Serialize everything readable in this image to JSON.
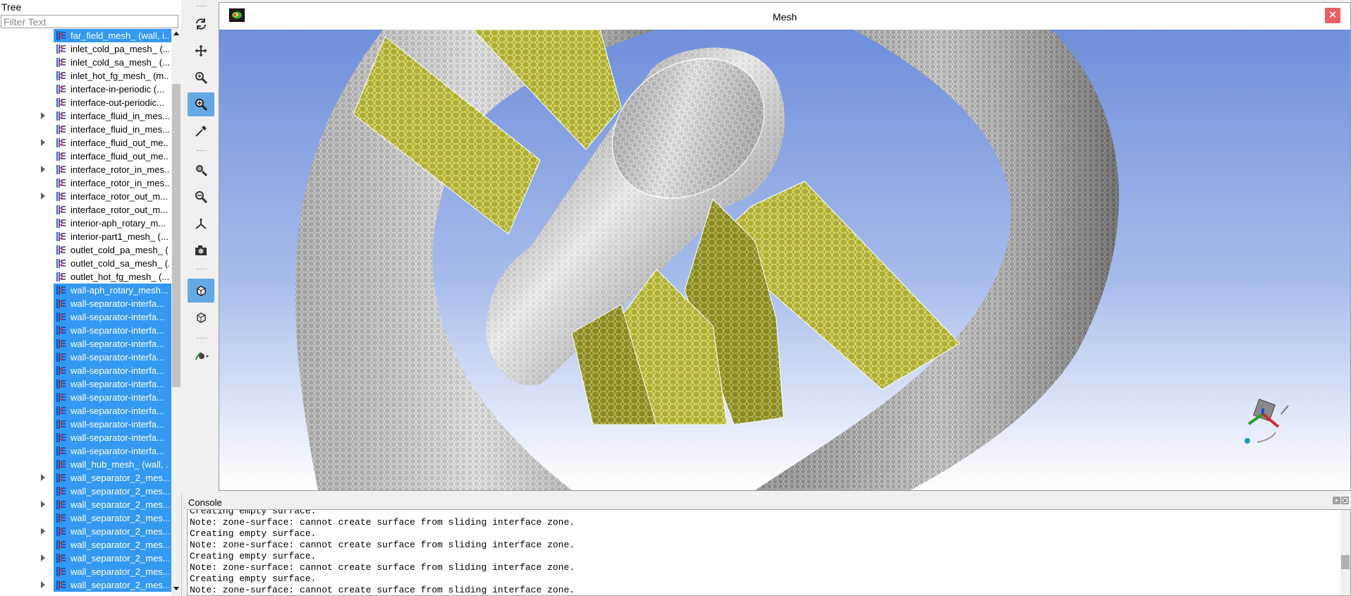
{
  "tree": {
    "title": "Tree",
    "filter_placeholder": "Filter Text",
    "items": [
      {
        "label": "far_field_mesh_ (wall, i...",
        "selected": true,
        "expandable": false
      },
      {
        "label": "inlet_cold_pa_mesh_ (...",
        "selected": false,
        "expandable": false
      },
      {
        "label": "inlet_cold_sa_mesh_ (...",
        "selected": false,
        "expandable": false
      },
      {
        "label": "inlet_hot_fg_mesh_ (m...",
        "selected": false,
        "expandable": false
      },
      {
        "label": "interface-in-periodic (...",
        "selected": false,
        "expandable": false
      },
      {
        "label": "interface-out-periodic...",
        "selected": false,
        "expandable": false
      },
      {
        "label": "interface_fluid_in_mes...",
        "selected": false,
        "expandable": true
      },
      {
        "label": "interface_fluid_in_mes...",
        "selected": false,
        "expandable": false
      },
      {
        "label": "interface_fluid_out_me...",
        "selected": false,
        "expandable": true
      },
      {
        "label": "interface_fluid_out_me...",
        "selected": false,
        "expandable": false
      },
      {
        "label": "interface_rotor_in_mes...",
        "selected": false,
        "expandable": true
      },
      {
        "label": "interface_rotor_in_mes...",
        "selected": false,
        "expandable": false
      },
      {
        "label": "interface_rotor_out_m...",
        "selected": false,
        "expandable": true
      },
      {
        "label": "interface_rotor_out_m...",
        "selected": false,
        "expandable": false
      },
      {
        "label": "interior-aph_rotary_m...",
        "selected": false,
        "expandable": false
      },
      {
        "label": "interior-part1_mesh_ (...",
        "selected": false,
        "expandable": false
      },
      {
        "label": "outlet_cold_pa_mesh_ (...",
        "selected": false,
        "expandable": false
      },
      {
        "label": "outlet_cold_sa_mesh_ (...",
        "selected": false,
        "expandable": false
      },
      {
        "label": "outlet_hot_fg_mesh_ (...",
        "selected": false,
        "expandable": false
      },
      {
        "label": "wall-aph_rotary_mesh...",
        "selected": true,
        "expandable": false
      },
      {
        "label": "wall-separator-interfa...",
        "selected": true,
        "expandable": false
      },
      {
        "label": "wall-separator-interfa...",
        "selected": true,
        "expandable": false
      },
      {
        "label": "wall-separator-interfa...",
        "selected": true,
        "expandable": false
      },
      {
        "label": "wall-separator-interfa...",
        "selected": true,
        "expandable": false
      },
      {
        "label": "wall-separator-interfa...",
        "selected": true,
        "expandable": false
      },
      {
        "label": "wall-separator-interfa...",
        "selected": true,
        "expandable": false
      },
      {
        "label": "wall-separator-interfa...",
        "selected": true,
        "expandable": false
      },
      {
        "label": "wall-separator-interfa...",
        "selected": true,
        "expandable": false
      },
      {
        "label": "wall-separator-interfa...",
        "selected": true,
        "expandable": false
      },
      {
        "label": "wall-separator-interfa...",
        "selected": true,
        "expandable": false
      },
      {
        "label": "wall-separator-interfa...",
        "selected": true,
        "expandable": false
      },
      {
        "label": "wall-separator-interfa...",
        "selected": true,
        "expandable": false
      },
      {
        "label": "wall_hub_mesh_ (wall, ...",
        "selected": true,
        "expandable": false
      },
      {
        "label": "wall_separator_2_mes...",
        "selected": true,
        "expandable": true
      },
      {
        "label": "wall_separator_2_mes...",
        "selected": true,
        "expandable": false
      },
      {
        "label": "wall_separator_2_mes...",
        "selected": true,
        "expandable": true
      },
      {
        "label": "wall_separator_2_mes...",
        "selected": true,
        "expandable": false
      },
      {
        "label": "wall_separator_2_mes...",
        "selected": true,
        "expandable": true
      },
      {
        "label": "wall_separator_2_mes...",
        "selected": true,
        "expandable": false
      },
      {
        "label": "wall_separator_2_mes...",
        "selected": true,
        "expandable": true
      },
      {
        "label": "wall_separator_2_mes...",
        "selected": true,
        "expandable": false
      },
      {
        "label": "wall_separator_2_mes...",
        "selected": true,
        "expandable": true
      }
    ]
  },
  "toolbar": {
    "buttons": [
      {
        "name": "rotate-icon",
        "active": false
      },
      {
        "name": "pan-icon",
        "active": false
      },
      {
        "name": "zoom-icon",
        "active": false
      },
      {
        "name": "zoom-box-icon",
        "active": true
      },
      {
        "name": "probe-icon",
        "active": false
      },
      {
        "name": "fit-to-window-icon",
        "active": false
      },
      {
        "name": "zoom-out-icon",
        "active": false
      },
      {
        "name": "axes-icon",
        "active": false
      },
      {
        "name": "camera-icon",
        "active": false
      },
      {
        "name": "solid-view-icon",
        "active": true
      },
      {
        "name": "wireframe-view-icon",
        "active": false
      },
      {
        "name": "view-options-icon",
        "active": false
      }
    ]
  },
  "viewport": {
    "title": "Mesh",
    "close_label": "✕",
    "colors": {
      "sky_top": "#6f8fdb",
      "sky_bottom": "#ffffff",
      "mesh_gray": "#b8b8b8",
      "mesh_yellow": "#b3b33b"
    }
  },
  "console": {
    "title": "Console",
    "lines": [
      "Creating empty surface.",
      "Note: zone-surface: cannot create surface from sliding interface zone.",
      "Creating empty surface.",
      "Note: zone-surface: cannot create surface from sliding interface zone.",
      "Creating empty surface.",
      "Note: zone-surface: cannot create surface from sliding interface zone.",
      "Creating empty surface.",
      "Note: zone-surface: cannot create surface from sliding interface zone."
    ]
  }
}
